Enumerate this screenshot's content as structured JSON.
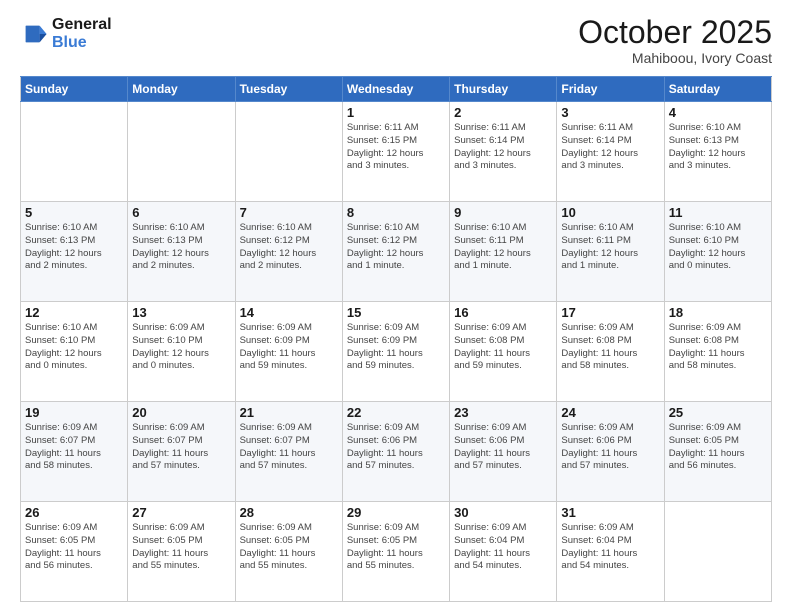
{
  "header": {
    "logo_line1": "General",
    "logo_line2": "Blue",
    "month": "October 2025",
    "location": "Mahiboou, Ivory Coast"
  },
  "weekdays": [
    "Sunday",
    "Monday",
    "Tuesday",
    "Wednesday",
    "Thursday",
    "Friday",
    "Saturday"
  ],
  "weeks": [
    [
      {
        "day": "",
        "info": ""
      },
      {
        "day": "",
        "info": ""
      },
      {
        "day": "",
        "info": ""
      },
      {
        "day": "1",
        "info": "Sunrise: 6:11 AM\nSunset: 6:15 PM\nDaylight: 12 hours\nand 3 minutes."
      },
      {
        "day": "2",
        "info": "Sunrise: 6:11 AM\nSunset: 6:14 PM\nDaylight: 12 hours\nand 3 minutes."
      },
      {
        "day": "3",
        "info": "Sunrise: 6:11 AM\nSunset: 6:14 PM\nDaylight: 12 hours\nand 3 minutes."
      },
      {
        "day": "4",
        "info": "Sunrise: 6:10 AM\nSunset: 6:13 PM\nDaylight: 12 hours\nand 3 minutes."
      }
    ],
    [
      {
        "day": "5",
        "info": "Sunrise: 6:10 AM\nSunset: 6:13 PM\nDaylight: 12 hours\nand 2 minutes."
      },
      {
        "day": "6",
        "info": "Sunrise: 6:10 AM\nSunset: 6:13 PM\nDaylight: 12 hours\nand 2 minutes."
      },
      {
        "day": "7",
        "info": "Sunrise: 6:10 AM\nSunset: 6:12 PM\nDaylight: 12 hours\nand 2 minutes."
      },
      {
        "day": "8",
        "info": "Sunrise: 6:10 AM\nSunset: 6:12 PM\nDaylight: 12 hours\nand 1 minute."
      },
      {
        "day": "9",
        "info": "Sunrise: 6:10 AM\nSunset: 6:11 PM\nDaylight: 12 hours\nand 1 minute."
      },
      {
        "day": "10",
        "info": "Sunrise: 6:10 AM\nSunset: 6:11 PM\nDaylight: 12 hours\nand 1 minute."
      },
      {
        "day": "11",
        "info": "Sunrise: 6:10 AM\nSunset: 6:10 PM\nDaylight: 12 hours\nand 0 minutes."
      }
    ],
    [
      {
        "day": "12",
        "info": "Sunrise: 6:10 AM\nSunset: 6:10 PM\nDaylight: 12 hours\nand 0 minutes."
      },
      {
        "day": "13",
        "info": "Sunrise: 6:09 AM\nSunset: 6:10 PM\nDaylight: 12 hours\nand 0 minutes."
      },
      {
        "day": "14",
        "info": "Sunrise: 6:09 AM\nSunset: 6:09 PM\nDaylight: 11 hours\nand 59 minutes."
      },
      {
        "day": "15",
        "info": "Sunrise: 6:09 AM\nSunset: 6:09 PM\nDaylight: 11 hours\nand 59 minutes."
      },
      {
        "day": "16",
        "info": "Sunrise: 6:09 AM\nSunset: 6:08 PM\nDaylight: 11 hours\nand 59 minutes."
      },
      {
        "day": "17",
        "info": "Sunrise: 6:09 AM\nSunset: 6:08 PM\nDaylight: 11 hours\nand 58 minutes."
      },
      {
        "day": "18",
        "info": "Sunrise: 6:09 AM\nSunset: 6:08 PM\nDaylight: 11 hours\nand 58 minutes."
      }
    ],
    [
      {
        "day": "19",
        "info": "Sunrise: 6:09 AM\nSunset: 6:07 PM\nDaylight: 11 hours\nand 58 minutes."
      },
      {
        "day": "20",
        "info": "Sunrise: 6:09 AM\nSunset: 6:07 PM\nDaylight: 11 hours\nand 57 minutes."
      },
      {
        "day": "21",
        "info": "Sunrise: 6:09 AM\nSunset: 6:07 PM\nDaylight: 11 hours\nand 57 minutes."
      },
      {
        "day": "22",
        "info": "Sunrise: 6:09 AM\nSunset: 6:06 PM\nDaylight: 11 hours\nand 57 minutes."
      },
      {
        "day": "23",
        "info": "Sunrise: 6:09 AM\nSunset: 6:06 PM\nDaylight: 11 hours\nand 57 minutes."
      },
      {
        "day": "24",
        "info": "Sunrise: 6:09 AM\nSunset: 6:06 PM\nDaylight: 11 hours\nand 57 minutes."
      },
      {
        "day": "25",
        "info": "Sunrise: 6:09 AM\nSunset: 6:05 PM\nDaylight: 11 hours\nand 56 minutes."
      }
    ],
    [
      {
        "day": "26",
        "info": "Sunrise: 6:09 AM\nSunset: 6:05 PM\nDaylight: 11 hours\nand 56 minutes."
      },
      {
        "day": "27",
        "info": "Sunrise: 6:09 AM\nSunset: 6:05 PM\nDaylight: 11 hours\nand 55 minutes."
      },
      {
        "day": "28",
        "info": "Sunrise: 6:09 AM\nSunset: 6:05 PM\nDaylight: 11 hours\nand 55 minutes."
      },
      {
        "day": "29",
        "info": "Sunrise: 6:09 AM\nSunset: 6:05 PM\nDaylight: 11 hours\nand 55 minutes."
      },
      {
        "day": "30",
        "info": "Sunrise: 6:09 AM\nSunset: 6:04 PM\nDaylight: 11 hours\nand 54 minutes."
      },
      {
        "day": "31",
        "info": "Sunrise: 6:09 AM\nSunset: 6:04 PM\nDaylight: 11 hours\nand 54 minutes."
      },
      {
        "day": "",
        "info": ""
      }
    ]
  ]
}
